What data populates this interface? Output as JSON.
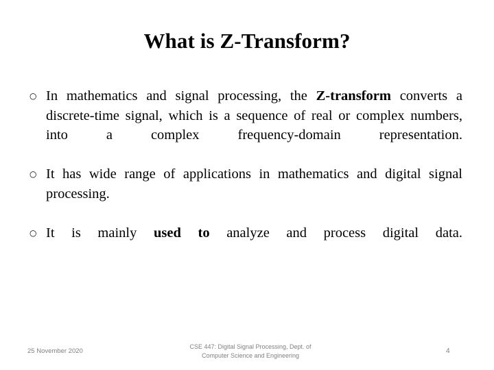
{
  "slide": {
    "title": "What is Z-Transform?",
    "bullet_marker": "○",
    "bullets": [
      {
        "marker": "○",
        "parts": [
          {
            "text": "In mathematics and signal processing, the ",
            "bold": false
          },
          {
            "text": "Z-transform",
            "bold": true
          },
          {
            "text": " converts a discrete-time signal, which is a sequence of real or complex numbers, into a complex frequency-domain representation.",
            "bold": false
          }
        ],
        "plain": "In mathematics and signal processing, the Z-transform converts a discrete-time signal, which is a sequence of real or complex numbers, into a complex frequency-domain representation."
      },
      {
        "marker": "○",
        "parts": [
          {
            "text": "It has wide range of applications in mathematics and digital signal processing.",
            "bold": false
          }
        ],
        "plain": "It has wide range of applications in mathematics and digital signal processing."
      },
      {
        "marker": "○",
        "parts": [
          {
            "text": "It is mainly ",
            "bold": false
          },
          {
            "text": "used to",
            "bold": true
          },
          {
            "text": " analyze and process digital data.",
            "bold": false
          }
        ],
        "plain": "It is mainly used to analyze and process digital data."
      }
    ]
  },
  "footer": {
    "date": "25 November 2020",
    "course_line_1": "CSE 447: Digital Signal Processing, Dept. of",
    "course_line_2": "Computer Science and Engineering",
    "page_number": "4"
  },
  "colors": {
    "background": "#ffffff",
    "text": "#000000",
    "footer_text": "#808080"
  }
}
